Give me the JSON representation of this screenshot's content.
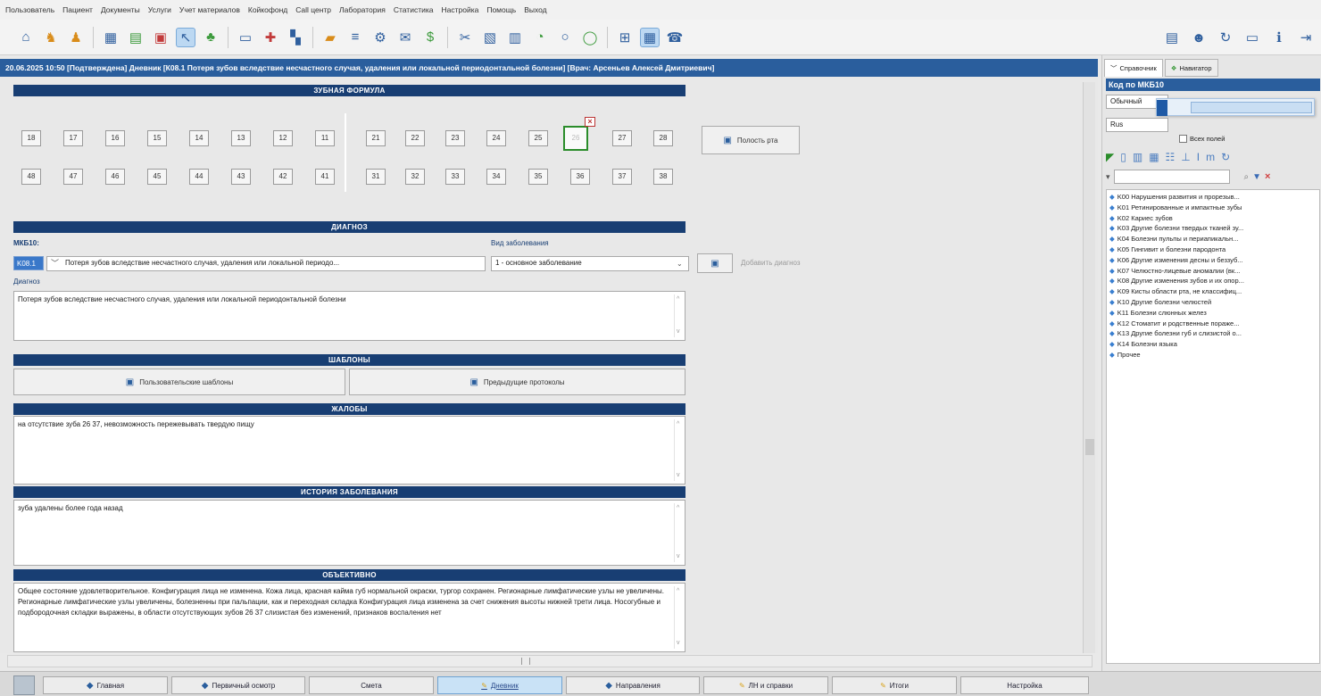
{
  "menu": [
    "Пользователь",
    "Пациент",
    "Документы",
    "Услуги",
    "Учет материалов",
    "Койкофонд",
    "Call центр",
    "Лаборатория",
    "Статистика",
    "Настройка",
    "Помощь",
    "Выход"
  ],
  "window_title": "20.06.2025 10:50 [Подтверждена] Дневник [К08.1 Потеря зубов вследствие несчастного случая, удаления или локальной периодонтальной болезни]  [Врач: Арсеньев Алексей Дмитриевич]",
  "sections": {
    "formula": "ЗУБНАЯ ФОРМУЛА",
    "diagnosis": "ДИАГНОЗ",
    "templates": "ШАБЛОНЫ",
    "complaints": "ЖАЛОБЫ",
    "history": "ИСТОРИЯ ЗАБОЛЕВАНИЯ",
    "objective": "ОБЪЕКТИВНО"
  },
  "teeth": {
    "upper_right": [
      "18",
      "17",
      "16",
      "15",
      "14",
      "13",
      "12",
      "11"
    ],
    "upper_left": [
      "21",
      "22",
      "23",
      "24",
      "25",
      "26",
      "27",
      "28"
    ],
    "lower_right": [
      "48",
      "47",
      "46",
      "45",
      "44",
      "43",
      "42",
      "41"
    ],
    "lower_left": [
      "31",
      "32",
      "33",
      "34",
      "35",
      "36",
      "37",
      "38"
    ]
  },
  "buttons": {
    "oral_cavity": "Полость рта",
    "add_diagnosis": "Добавить диагноз",
    "user_templates": "Пользовательские шаблоны",
    "prev_protocols": "Предыдущие протоколы"
  },
  "diagnosis": {
    "mkb_label": "МКБ10:",
    "mkb_code": "K08.1",
    "mkb_value": "Потеря зубов вследствие несчастного случая, удаления или локальной периодо...",
    "kind_label": "Вид заболевания",
    "kind_value": "1 - основное заболевание",
    "diag_label": "Диагноз",
    "diag_text": "Потеря зубов вследствие несчастного случая, удаления или локальной периодонтальной болезни"
  },
  "complaints_text": "на отсутствие зуба 26 37, невозможность пережевывать твердую пищу",
  "history_text": "зуба удалены более года назад",
  "objective_text": "Общее состояние удовлетворительное. Конфигурация лица не изменена. Кожа лица, красная кайма губ нормальной окраски, тургор сохранен. Регионарные лимфатические узлы не увеличены. Регионарные лимфатические узлы увеличены, болезненны при пальпации, как и переходная складка Конфигурация лица изменена за счет снижения высоты нижней трети лица. Носогубные и подбородочная складки выражены, в области отсутствующих зубов 26 37 слизистая без изменений, признаков воспаления нет",
  "right_panel": {
    "tabs": [
      "Справочник",
      "Навигатор"
    ],
    "header": "Код по МКБ10",
    "filter_label": "Обычный",
    "search_by": "Rus",
    "all_fields": "Всех полей",
    "items": [
      "K00 Нарушения развития и прорезыв...",
      "K01 Ретинированные и импактные зубы",
      "K02 Кариес зубов",
      "K03 Другие болезни твердых тканей зу...",
      "K04 Болезни пульпы и периапикальн...",
      "K05 Гингивит и болезни пародонта",
      "K06 Другие изменения десны и беззуб...",
      "K07 Челюстно-лицевые аномалии (вк...",
      "K08 Другие изменения зубов и их опор...",
      "K09 Кисты области рта, не классифиц...",
      "K10 Другие болезни челюстей",
      "K11 Болезни слюнных желез",
      "K12 Стоматит и родственные пораже...",
      "K13 Другие болезни губ и слизистой о...",
      "K14 Болезни языка",
      "Прочее"
    ]
  },
  "taskbar": [
    "Главная",
    "Первичный осмотр",
    "Смета",
    "Дневник",
    "Направления",
    "ЛН и справки",
    "Итоги",
    "Настройка"
  ]
}
